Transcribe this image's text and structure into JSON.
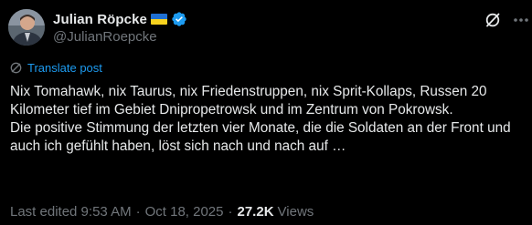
{
  "author": {
    "display_name": "Julian Röpcke",
    "handle": "@JulianRoepcke",
    "flag_icon": "ukraine-flag-icon",
    "verified_icon": "verified-badge-icon",
    "colors": {
      "verified": "#1d9bf0",
      "flag_blue": "#1f6fd1",
      "flag_yellow": "#f7d21e"
    }
  },
  "actions": {
    "grok_icon": "grok-slash-icon",
    "more_icon": "more-dots-icon"
  },
  "translate": {
    "label": "Translate post",
    "icon": "translate-globe-icon",
    "color": "#1d9bf0"
  },
  "post": {
    "lines": [
      "Nix Tomahawk, nix Taurus, nix Friedenstruppen, nix Sprit-Kollaps, Russen 20 Kilometer tief im Gebiet Dnipropetrowsk und im Zentrum von Pokrowsk.",
      "Die positive Stimmung der letzten vier Monate, die die Soldaten an der Front und auch ich gefühlt haben, löst sich nach und nach auf …"
    ]
  },
  "meta": {
    "edited": "Last edited 9:53 AM",
    "separator": "·",
    "date": "Oct 18, 2025",
    "views_count": "27.2K",
    "views_label": "Views"
  }
}
